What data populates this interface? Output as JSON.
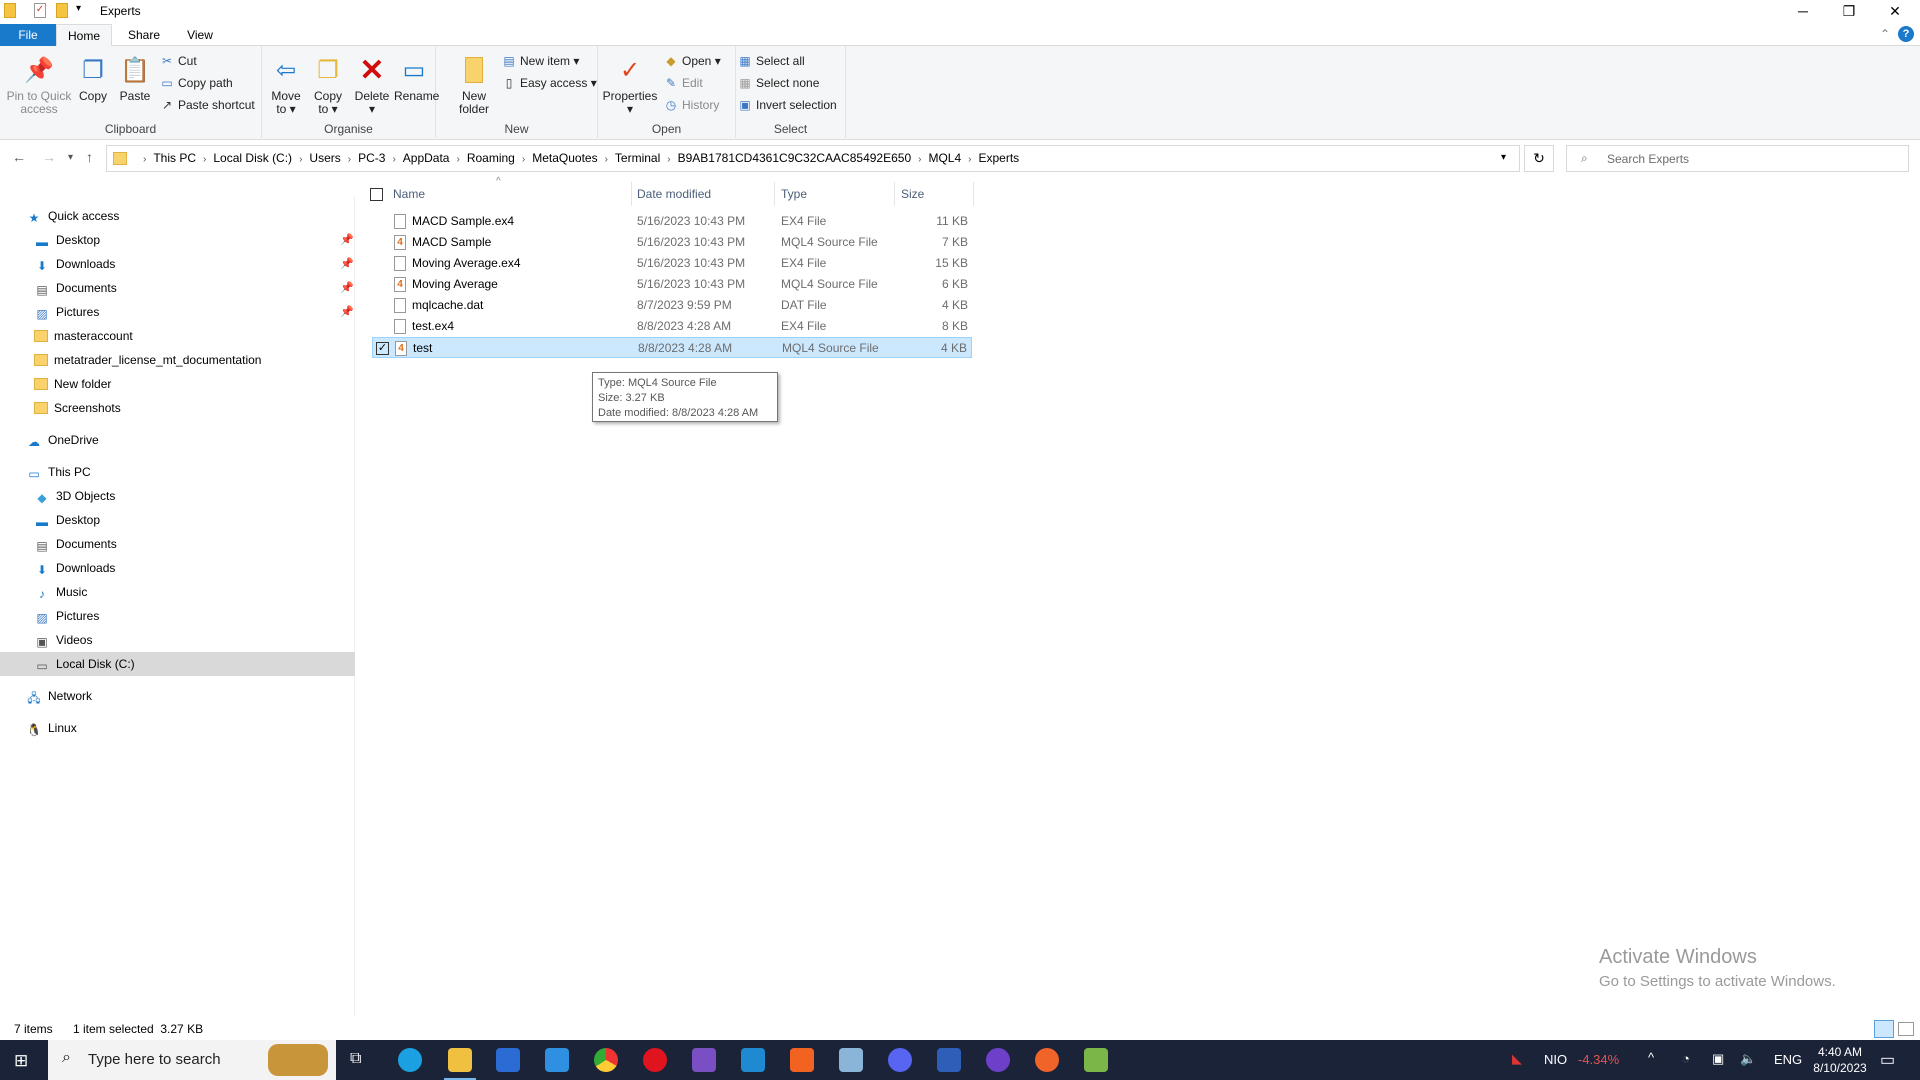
{
  "window": {
    "title": "Experts"
  },
  "ribbon_tabs": [
    "File",
    "Home",
    "Share",
    "View"
  ],
  "clipboard": {
    "label": "Clipboard",
    "pin": "Pin to Quick access",
    "copy": "Copy",
    "paste": "Paste",
    "cut": "Cut",
    "copy_path": "Copy path",
    "paste_shortcut": "Paste shortcut"
  },
  "organise": {
    "label": "Organise",
    "move_to": "Move to",
    "copy_to": "Copy to",
    "delete": "Delete",
    "rename": "Rename"
  },
  "new": {
    "label": "New",
    "new_folder": "New folder",
    "new_item": "New item",
    "easy_access": "Easy access"
  },
  "open": {
    "label": "Open",
    "properties": "Properties",
    "open": "Open",
    "edit": "Edit",
    "history": "History"
  },
  "select": {
    "label": "Select",
    "select_all": "Select all",
    "select_none": "Select none",
    "invert": "Invert selection"
  },
  "breadcrumb": [
    "This PC",
    "Local Disk (C:)",
    "Users",
    "PC-3",
    "AppData",
    "Roaming",
    "MetaQuotes",
    "Terminal",
    "B9AB1781CD4361C9C32CAAC85492E650",
    "MQL4",
    "Experts"
  ],
  "search": {
    "placeholder": "Search Experts"
  },
  "nav": {
    "quick_access": "Quick access",
    "quick_items": [
      "Desktop",
      "Downloads",
      "Documents",
      "Pictures",
      "masteraccount",
      "metatrader_license_mt_documentation",
      "New folder",
      "Screenshots"
    ],
    "onedrive": "OneDrive",
    "this_pc": "This PC",
    "pc_items": [
      "3D Objects",
      "Desktop",
      "Documents",
      "Downloads",
      "Music",
      "Pictures",
      "Videos",
      "Local Disk (C:)"
    ],
    "network": "Network",
    "linux": "Linux"
  },
  "columns": [
    "Name",
    "Date modified",
    "Type",
    "Size"
  ],
  "files": [
    {
      "name": "MACD Sample.ex4",
      "date": "5/16/2023 10:43 PM",
      "type": "EX4 File",
      "size": "11 KB"
    },
    {
      "name": "MACD Sample",
      "date": "5/16/2023 10:43 PM",
      "type": "MQL4 Source File",
      "size": "7 KB"
    },
    {
      "name": "Moving Average.ex4",
      "date": "5/16/2023 10:43 PM",
      "type": "EX4 File",
      "size": "15 KB"
    },
    {
      "name": "Moving Average",
      "date": "5/16/2023 10:43 PM",
      "type": "MQL4 Source File",
      "size": "6 KB"
    },
    {
      "name": "mqlcache.dat",
      "date": "8/7/2023 9:59 PM",
      "type": "DAT File",
      "size": "4 KB"
    },
    {
      "name": "test.ex4",
      "date": "8/8/2023 4:28 AM",
      "type": "EX4 File",
      "size": "8 KB"
    },
    {
      "name": "test",
      "date": "8/8/2023 4:28 AM",
      "type": "MQL4 Source File",
      "size": "4 KB"
    }
  ],
  "tooltip": [
    "Type: MQL4 Source File",
    "Size: 3.27 KB",
    "Date modified: 8/8/2023 4:28 AM"
  ],
  "status": {
    "count": "7 items",
    "selected": "1 item selected  3.27 KB"
  },
  "watermark": {
    "line1": "Activate Windows",
    "line2": "Go to Settings to activate Windows."
  },
  "taskbar": {
    "search": "Type here to search",
    "stock": "NIO",
    "change": "-4.34%",
    "lang": "ENG",
    "time": "4:40 AM",
    "date": "8/10/2023"
  },
  "colors": {
    "accent": "#1979ca",
    "selection": "#cce8ff",
    "taskbar": "#1b2338",
    "negative": "#e05555"
  }
}
